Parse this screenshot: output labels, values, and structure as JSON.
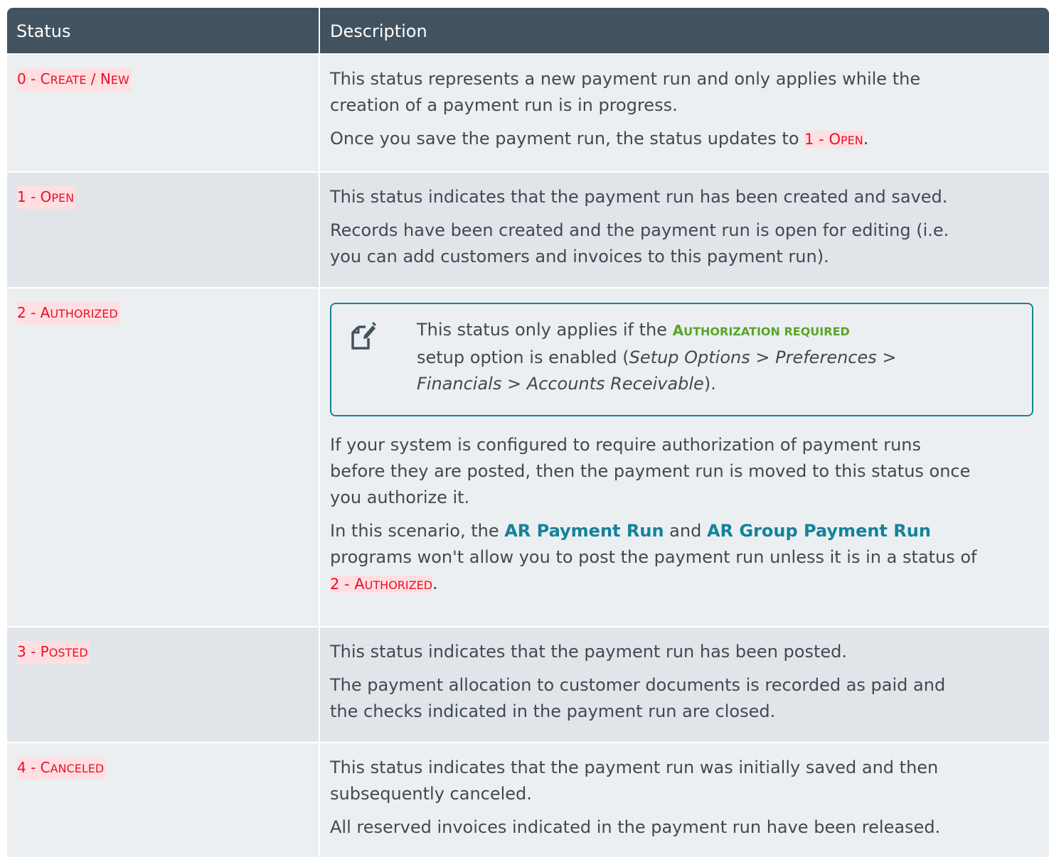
{
  "header": {
    "status_col": "Status",
    "description_col": "Description"
  },
  "colors": {
    "header_bg": "#42525f",
    "row_light": "#eceff1",
    "row_dark": "#e1e5e9",
    "status_text": "#e8102a",
    "status_highlight": "#ffdfe1",
    "note_border": "#14829b",
    "program_link": "#14829b",
    "option_green": "#58a52a"
  },
  "rows": [
    {
      "status_num": "0 - ",
      "status_cap1": "C",
      "status_sm1": "REATE",
      "status_mid": " / ",
      "status_cap2": "N",
      "status_sm2": "EW",
      "p1_line1": "This status represents a new payment run and only applies while the",
      "p1_line2": "creation of a payment run is in progress.",
      "p2_before": "Once you save the payment run, the status updates to ",
      "p2_status_num": "1 - ",
      "p2_status_cap": "O",
      "p2_status_sm": "PEN",
      "p2_after": "."
    },
    {
      "status_num": "1 - ",
      "status_cap1": "O",
      "status_sm1": "PEN",
      "p1_line1": "This status indicates that the payment run has been created and saved.",
      "p2_line1": "Records have been created and the payment run is open for editing (i.e.",
      "p2_line2": "you can add customers and invoices to this payment run)."
    },
    {
      "status_num": "2 - ",
      "status_cap1": "A",
      "status_sm1": "UTHORIZED",
      "note": {
        "icon": "note-edit-icon",
        "line1_before": "This status only applies if the ",
        "option_cap1": "A",
        "option_sm1": "UTHORIZATION REQUIRED",
        "line2": "setup option is enabled (",
        "path1": "Setup Options",
        "sep1": " > ",
        "path2": "Preferences",
        "sep2": " >",
        "path3": "Financials",
        "sep3": " > ",
        "path4": "Accounts Receivable",
        "line3_after": ")."
      },
      "p1_line1": "If your system is configured to require authorization of payment runs",
      "p1_line2": "before they are posted, then the payment run is moved to this status once",
      "p1_line3": "you authorize it.",
      "p2_before": "In this scenario, the ",
      "p2_prog1": "AR Payment Run",
      "p2_and": " and ",
      "p2_prog2": "AR Group Payment Run",
      "p2_line2": "programs won't allow you to post the payment run unless it is in a status of",
      "p2_status_num": "2 - ",
      "p2_status_cap": "A",
      "p2_status_sm": "UTHORIZED",
      "p2_after": "."
    },
    {
      "status_num": "3 - ",
      "status_cap1": "P",
      "status_sm1": "OSTED",
      "p1_line1": "This status indicates that the payment run has been posted.",
      "p2_line1": "The payment allocation to customer documents is recorded as paid and",
      "p2_line2": "the checks indicated in the payment run are closed."
    },
    {
      "status_num": "4 - ",
      "status_cap1": "C",
      "status_sm1": "ANCELED",
      "p1_line1": "This status indicates that the payment run was initially saved and then",
      "p1_line2": "subsequently canceled.",
      "p2_line1": "All reserved invoices indicated in the payment run have been released."
    }
  ]
}
